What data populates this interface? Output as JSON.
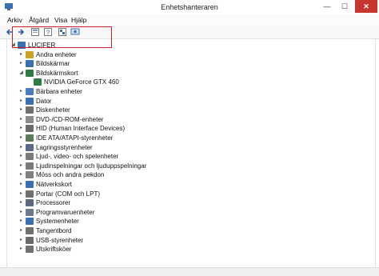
{
  "window": {
    "title": "Enhetshanteraren",
    "minimize": "—",
    "maximize": "☐",
    "close": "✕"
  },
  "menu": [
    "Arkiv",
    "Åtgärd",
    "Visa",
    "Hjälp"
  ],
  "tree": {
    "root": "LUCIFER",
    "children": [
      {
        "label": "Andra enheter",
        "icon": "question-icon",
        "color": "#c9a227"
      },
      {
        "label": "Bildskärmar",
        "icon": "monitor-icon",
        "color": "#3a6fb0"
      },
      {
        "label": "Bildskärmskort",
        "icon": "display-adapter-icon",
        "color": "#2f7a45",
        "expanded": true,
        "children": [
          {
            "label": "NVIDIA GeForce GTX 460",
            "icon": "display-adapter-icon",
            "color": "#2f7a45"
          }
        ]
      },
      {
        "label": "Bärbara enheter",
        "icon": "portable-device-icon",
        "color": "#4a7cc0"
      },
      {
        "label": "Dator",
        "icon": "computer-icon",
        "color": "#3a6fb0"
      },
      {
        "label": "Diskenheter",
        "icon": "disk-drive-icon",
        "color": "#707070"
      },
      {
        "label": "DVD-/CD-ROM-enheter",
        "icon": "dvd-icon",
        "color": "#8a8a8a"
      },
      {
        "label": "HID (Human Interface Devices)",
        "icon": "hid-icon",
        "color": "#6a6a6a"
      },
      {
        "label": "IDE ATA/ATAPI-styrenheter",
        "icon": "ide-controller-icon",
        "color": "#5a7a5a"
      },
      {
        "label": "Lagringsstyrenheter",
        "icon": "storage-controller-icon",
        "color": "#5a6a8a"
      },
      {
        "label": "Ljud-, video- och spelenheter",
        "icon": "sound-icon",
        "color": "#7a7a7a"
      },
      {
        "label": "Ljudinspelningar och ljuduppspelningar",
        "icon": "speaker-icon",
        "color": "#7a7a7a"
      },
      {
        "label": "Möss och andra pekdon",
        "icon": "mouse-icon",
        "color": "#808080"
      },
      {
        "label": "Nätverkskort",
        "icon": "network-adapter-icon",
        "color": "#3a6fb0"
      },
      {
        "label": "Portar (COM och LPT)",
        "icon": "port-icon",
        "color": "#707070"
      },
      {
        "label": "Processorer",
        "icon": "processor-icon",
        "color": "#5a6a7a"
      },
      {
        "label": "Programvaruenheter",
        "icon": "software-device-icon",
        "color": "#6a7a8a"
      },
      {
        "label": "Systemenheter",
        "icon": "system-device-icon",
        "color": "#3a6fb0"
      },
      {
        "label": "Tangentbord",
        "icon": "keyboard-icon",
        "color": "#707070"
      },
      {
        "label": "USB-styrenheter",
        "icon": "usb-icon",
        "color": "#6a6a6a"
      },
      {
        "label": "Utskriftsköer",
        "icon": "printer-icon",
        "color": "#707070"
      }
    ]
  }
}
